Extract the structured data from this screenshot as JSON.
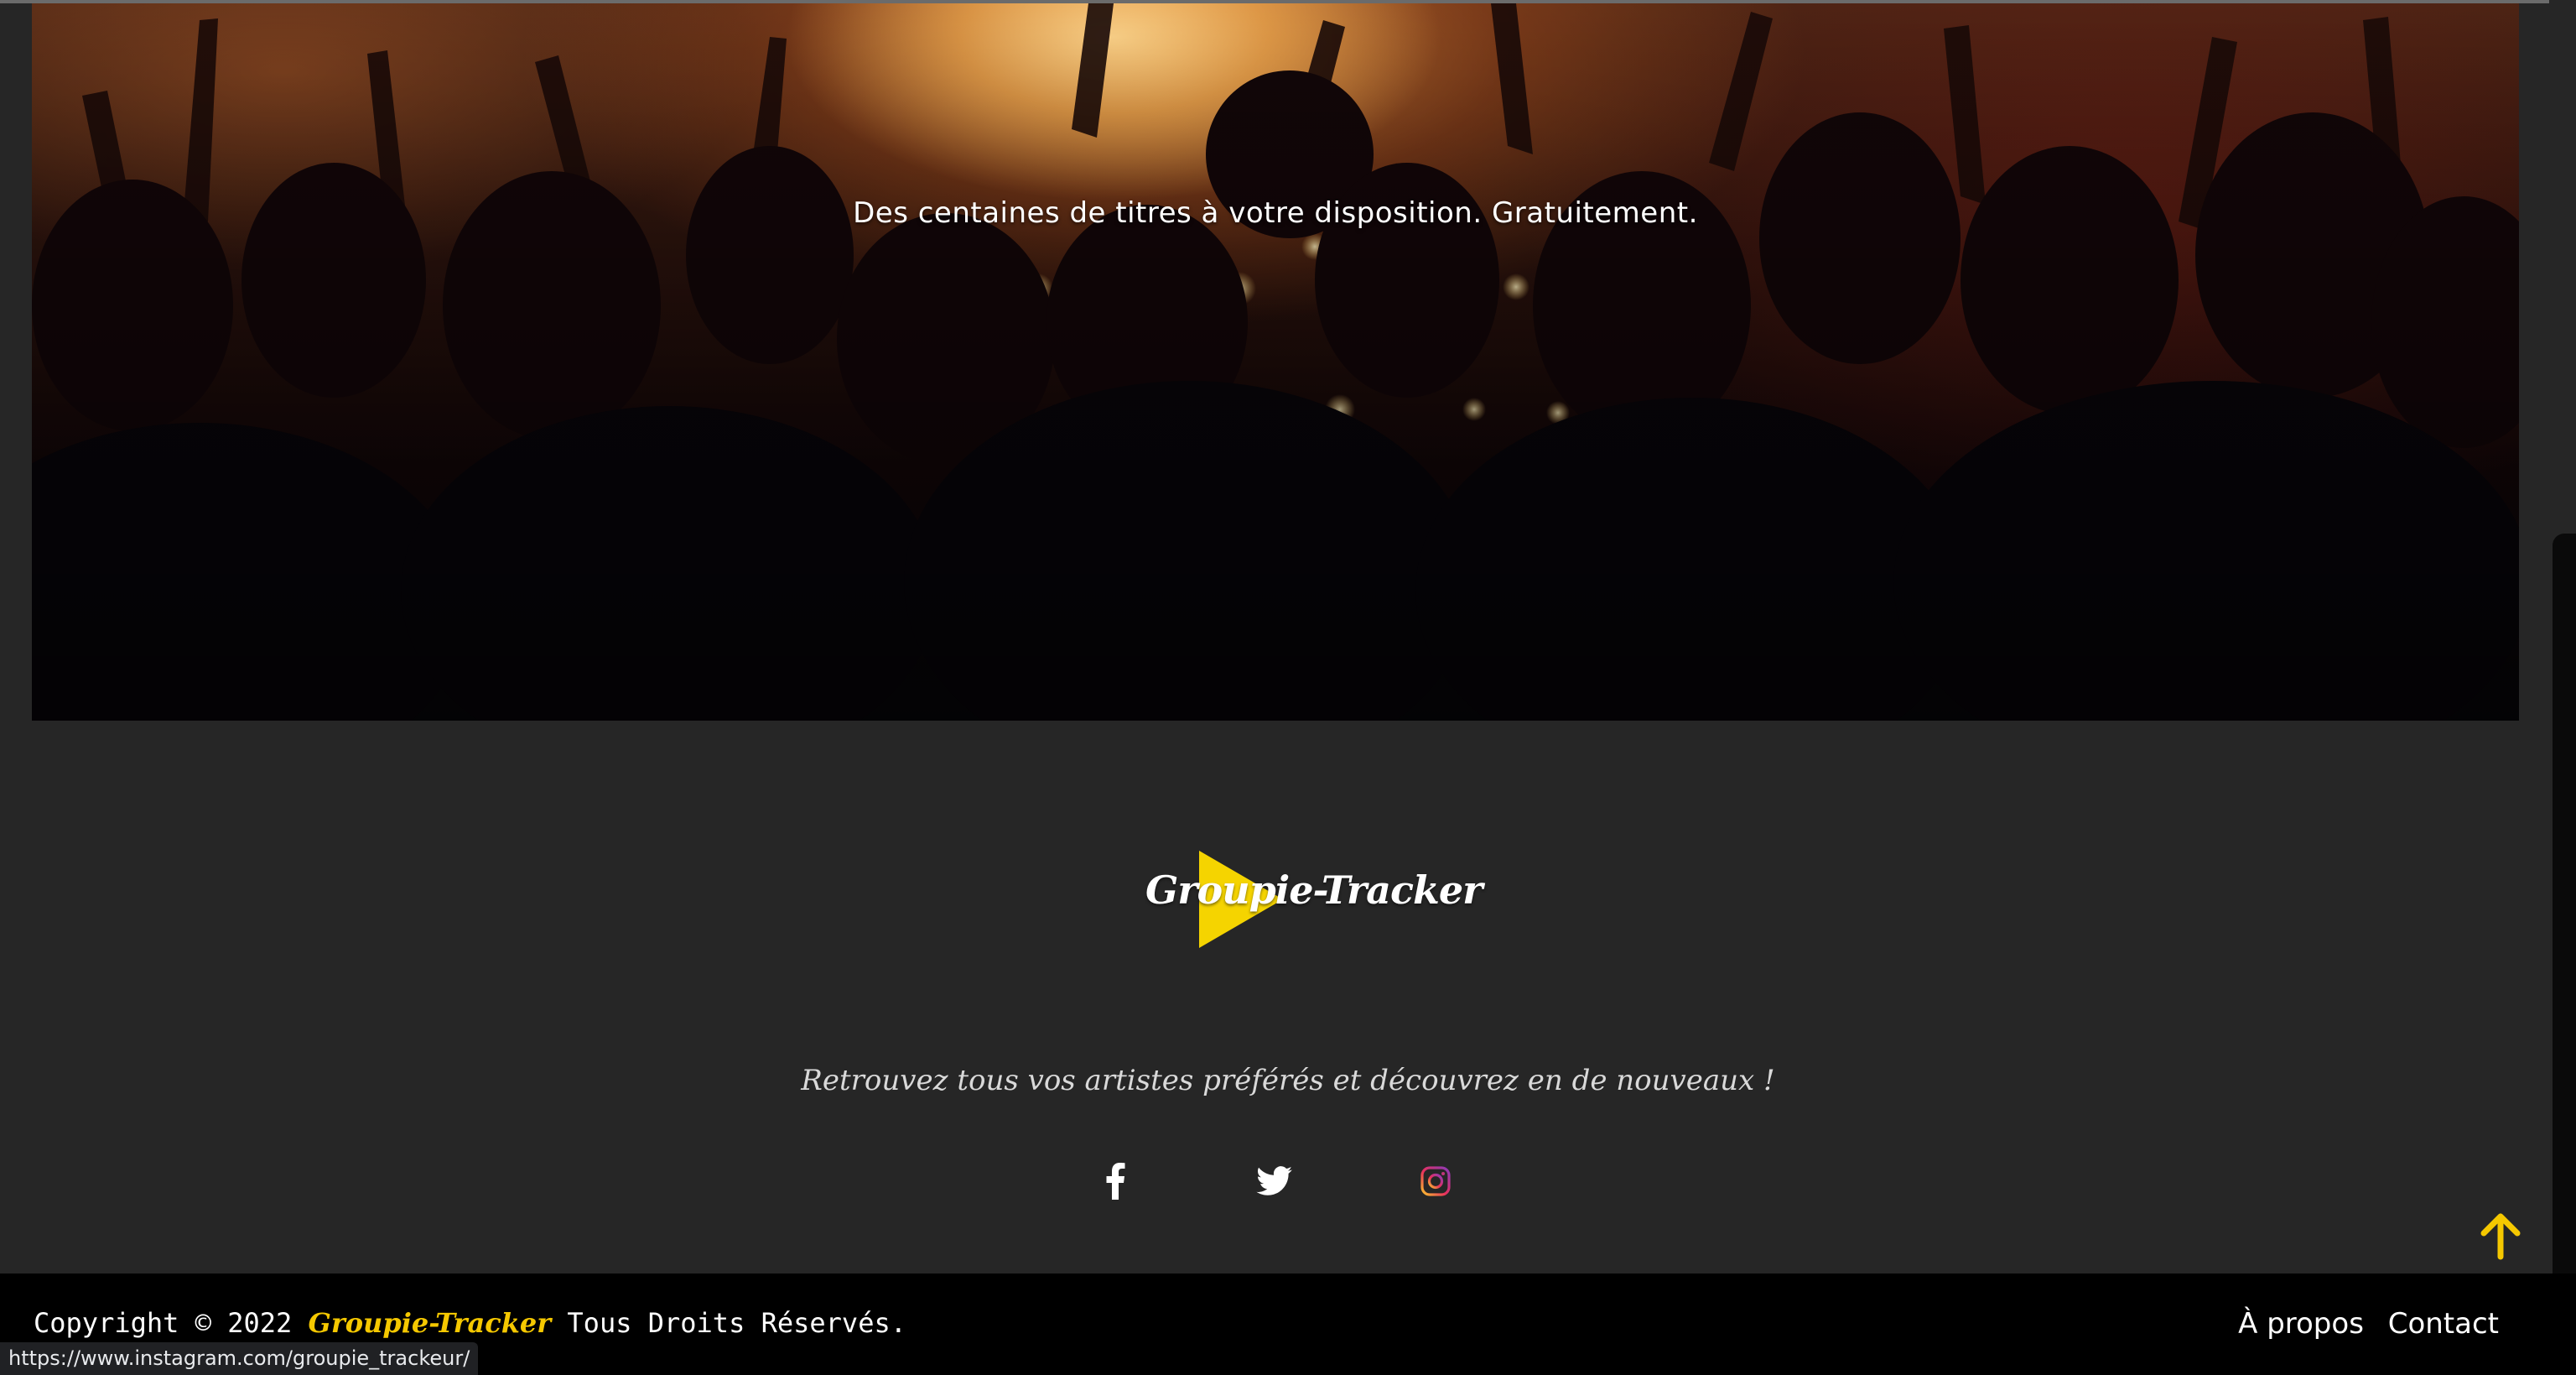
{
  "hero": {
    "tagline": "Des centaines de titres à votre disposition. Gratuitement."
  },
  "logo": {
    "name": "Groupie-Tracker",
    "triangle_color": "#f5d400"
  },
  "footer_top": {
    "tagline": "Retrouvez tous vos artistes préférés et découvrez en de nouveaux !",
    "socials": [
      {
        "icon": "facebook-icon",
        "label": "Facebook"
      },
      {
        "icon": "twitter-icon",
        "label": "Twitter"
      },
      {
        "icon": "instagram-icon",
        "label": "Instagram"
      }
    ]
  },
  "footer": {
    "copyright_prefix": "Copyright © 2022 ",
    "brand": "Groupie-Tracker",
    "copyright_suffix": " Tous Droits Réservés.",
    "links": {
      "about": "À propos",
      "contact": "Contact"
    }
  },
  "status_bar": {
    "url": "https://www.instagram.com/groupie_trackeur/"
  },
  "colors": {
    "accent": "#f5c800",
    "background": "#262626",
    "footer_bg": "#000000"
  }
}
